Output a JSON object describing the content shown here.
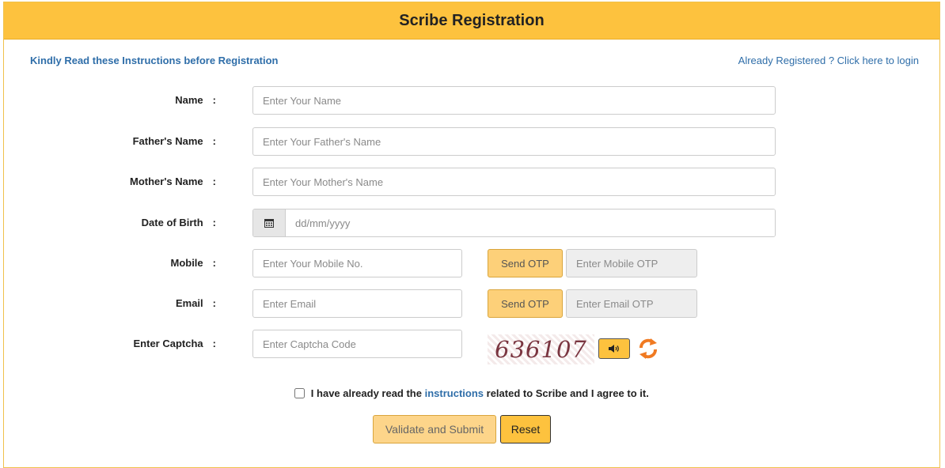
{
  "title": "Scribe Registration",
  "links": {
    "instructions": "Kindly Read these Instructions before Registration",
    "login": "Already Registered ? Click here to login"
  },
  "fields": {
    "name": {
      "label": "Name",
      "placeholder": "Enter Your Name"
    },
    "father": {
      "label": "Father's Name",
      "placeholder": "Enter Your Father's Name"
    },
    "mother": {
      "label": "Mother's Name",
      "placeholder": "Enter Your Mother's Name"
    },
    "dob": {
      "label": "Date of Birth",
      "placeholder": "dd/mm/yyyy",
      "icon": "calendar-icon"
    },
    "mobile": {
      "label": "Mobile",
      "placeholder": "Enter Your Mobile No.",
      "otp_button": "Send OTP",
      "otp_placeholder": "Enter Mobile OTP"
    },
    "email": {
      "label": "Email",
      "placeholder": "Enter Email",
      "otp_button": "Send OTP",
      "otp_placeholder": "Enter Email OTP"
    },
    "captcha": {
      "label": "Enter Captcha",
      "placeholder": "Enter Captcha Code",
      "code": "636107",
      "audio_icon": "speaker-icon",
      "refresh_icon": "refresh-icon"
    }
  },
  "colon": ":",
  "agree": {
    "prefix": "I have already read the",
    "link": "instructions",
    "suffix": "related to Scribe and I agree to it.",
    "checked": false
  },
  "buttons": {
    "submit": "Validate and Submit",
    "reset": "Reset"
  },
  "colors": {
    "header_bg": "#fdc23e",
    "link": "#2f6ea9",
    "button": "#fdd079"
  }
}
